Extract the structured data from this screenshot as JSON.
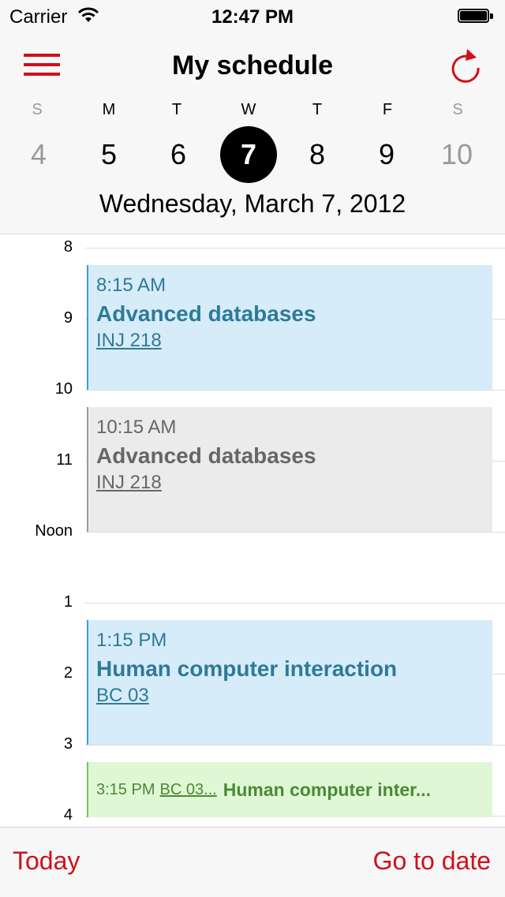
{
  "status_bar": {
    "carrier": "Carrier",
    "time": "12:47 PM"
  },
  "header": {
    "title": "My schedule"
  },
  "week": [
    {
      "weekday": "S",
      "day": "4"
    },
    {
      "weekday": "M",
      "day": "5"
    },
    {
      "weekday": "T",
      "day": "6"
    },
    {
      "weekday": "W",
      "day": "7"
    },
    {
      "weekday": "T",
      "day": "8"
    },
    {
      "weekday": "F",
      "day": "9"
    },
    {
      "weekday": "S",
      "day": "10"
    }
  ],
  "selected_date": "Wednesday, March 7, 2012",
  "hours": [
    "8",
    "9",
    "10",
    "11",
    "Noon",
    "1",
    "2",
    "3",
    "4"
  ],
  "events": [
    {
      "time": "8:15 AM",
      "name": "Advanced databases",
      "room": "INJ 218"
    },
    {
      "time": "10:15 AM",
      "name": "Advanced databases",
      "room": "INJ 218"
    },
    {
      "time": "1:15 PM",
      "name": "Human computer interaction",
      "room": "BC 03"
    },
    {
      "time": "3:15 PM",
      "room": "BC 03...",
      "name": "Human computer inter..."
    }
  ],
  "bottom_bar": {
    "today": "Today",
    "go_to_date": "Go to date"
  },
  "colors": {
    "accent": "#d0101b",
    "event_blue": "#d6ecf9",
    "event_gray": "#ebebeb",
    "event_green": "#dff7d4"
  }
}
